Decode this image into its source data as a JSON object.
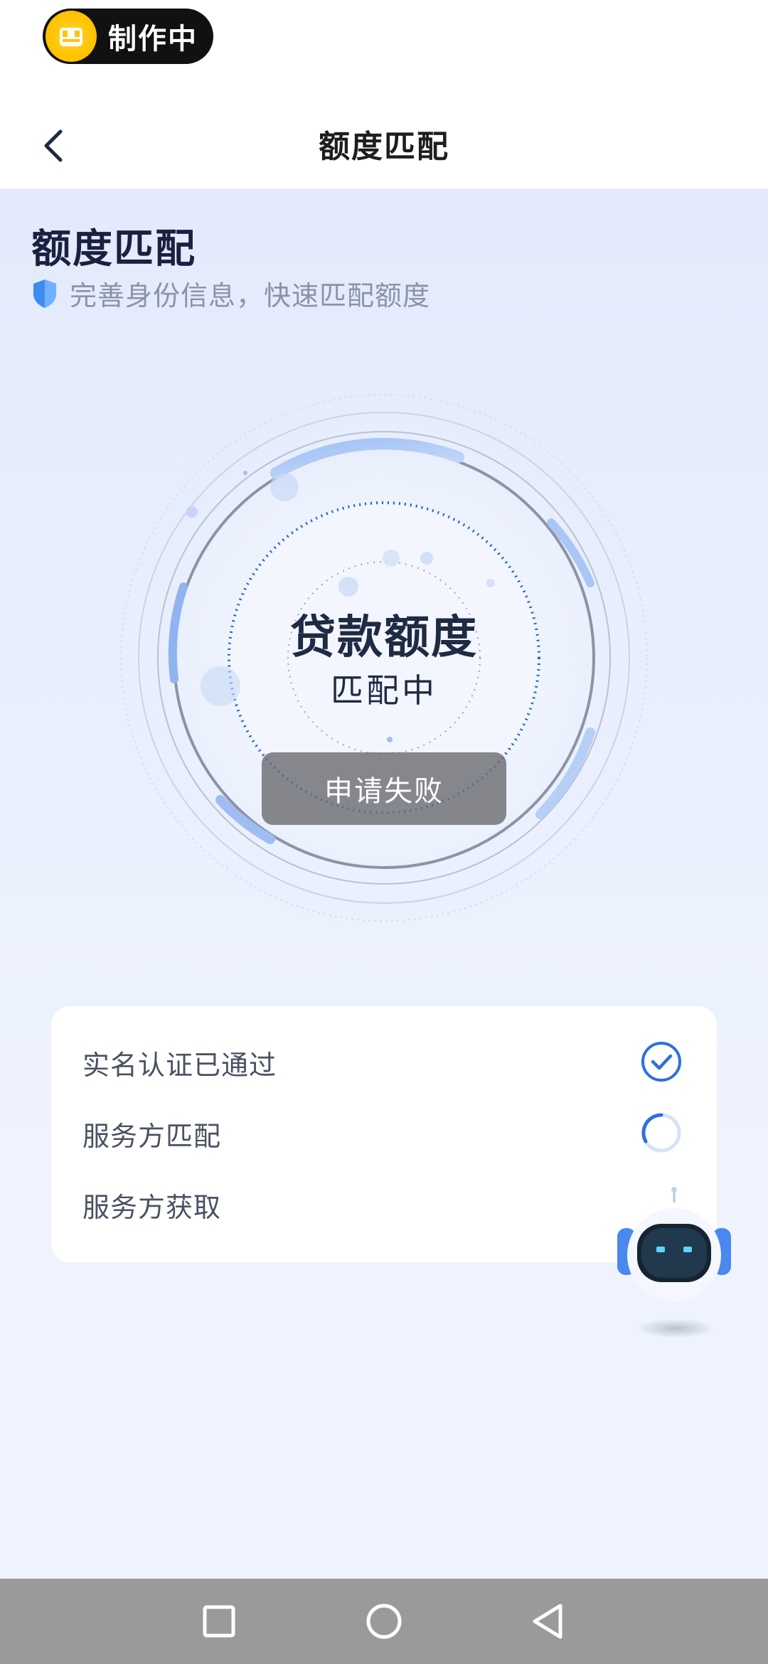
{
  "status": {
    "badge_label": "制作中"
  },
  "header": {
    "title": "额度匹配"
  },
  "main": {
    "section_title": "额度匹配",
    "subtitle": "完善身份信息，快速匹配额度",
    "center_title": "贷款额度",
    "center_status": "匹配中",
    "toast": "申请失败"
  },
  "steps": [
    {
      "label": "实名认证已通过",
      "state": "done"
    },
    {
      "label": "服务方匹配",
      "state": "loading"
    },
    {
      "label": "服务方获取",
      "state": "pending"
    }
  ],
  "navbar": {
    "icons": [
      "recent-apps-icon",
      "home-icon",
      "back-triangle-icon"
    ]
  },
  "colors": {
    "accent": "#2f6fdc",
    "ring_blue": "#8fb4f0",
    "text_dark": "#1f2a44",
    "toast_bg": "#6e6e73"
  }
}
